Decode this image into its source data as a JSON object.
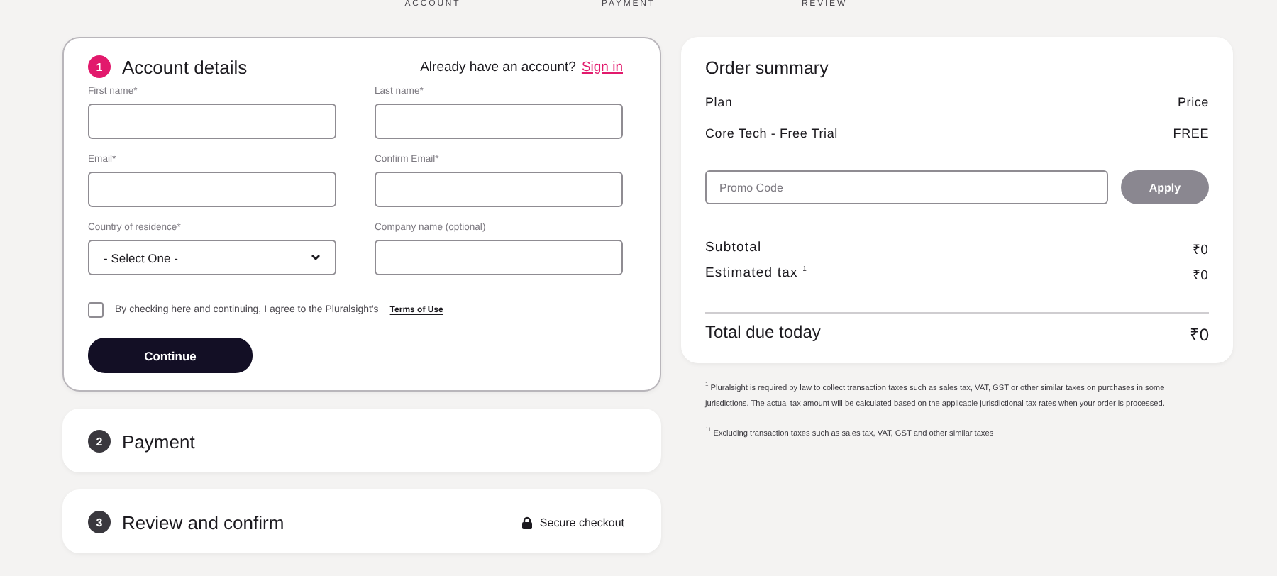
{
  "progress_steps": [
    {
      "label": "ACCOUNT"
    },
    {
      "label": "PAYMENT"
    },
    {
      "label": "REVIEW"
    }
  ],
  "steps": [
    {
      "number": "1",
      "title": "Account details",
      "active": true,
      "signin_prompt": "Already have an account?",
      "signin_link": "Sign in",
      "fields": [
        {
          "kind": "text",
          "label": "First name*"
        },
        {
          "kind": "text",
          "label": "Last name*"
        },
        {
          "kind": "text",
          "label": "Email*"
        },
        {
          "kind": "text",
          "label": "Confirm Email*"
        },
        {
          "kind": "select",
          "label": "Country of residence*",
          "value": "- Select One -"
        },
        {
          "kind": "text",
          "label": "Company name (optional)"
        }
      ],
      "terms": {
        "checked": false,
        "text": "By checking here and continuing, I agree to the Pluralsight's",
        "link": "Terms of Use"
      },
      "continue_button": "Continue"
    },
    {
      "number": "2",
      "title": "Payment",
      "active": false
    },
    {
      "number": "3",
      "title": "Review and confirm",
      "active": false,
      "note": "Secure checkout"
    }
  ],
  "order_summary": {
    "title": "Order summary",
    "header": {
      "plan": "Plan",
      "price": "Price"
    },
    "items": [
      {
        "plan": "Core Tech - Free Trial",
        "price": "FREE"
      }
    ],
    "promo": {
      "placeholder": "Promo Code",
      "button": "Apply"
    },
    "totals": [
      {
        "label": "Subtotal",
        "value": "₹0"
      },
      {
        "label": "Estimated tax $^{1}$",
        "value": "₹0"
      }
    ],
    "total": {
      "label": "Total due today",
      "value": "₹0"
    }
  },
  "footnotes": [
    "$^{1}$ Pluralsight is required by law to collect transaction taxes such as sales tax, VAT, GST or other similar taxes on purchases in some jurisdictions. The actual tax amount will be calculated based on the applicable jurisdictional tax rates when your order is processed.",
    "$^{11}$ Excluding transaction taxes such as sales tax, VAT, GST and other similar taxes"
  ]
}
